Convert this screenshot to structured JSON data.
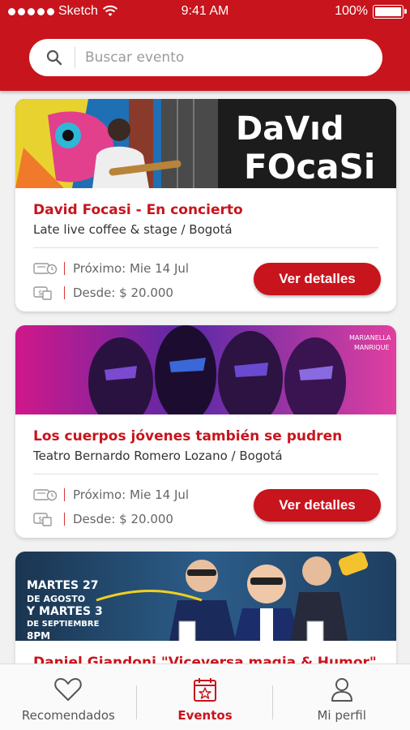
{
  "status_bar": {
    "carrier": "Sketch",
    "time": "9:41 AM",
    "battery": "100%"
  },
  "search": {
    "placeholder": "Buscar evento"
  },
  "events": [
    {
      "image_text": [
        "DaVıd",
        "FOcaSi"
      ],
      "title": "David Focasi  - En concierto",
      "venue": "Late live coffee & stage / Bogotá",
      "next_label": "Próximo: Mie 14 Jul",
      "price_label": "Desde: $ 20.000",
      "button": "Ver detalles"
    },
    {
      "image_text": [
        "MARIANELLA",
        "MANRIQUE"
      ],
      "title": "Los cuerpos jóvenes también se pudren",
      "venue": "Teatro Bernardo Romero Lozano / Bogotá",
      "next_label": "Próximo: Mie 14 Jul",
      "price_label": "Desde: $ 20.000",
      "button": "Ver detalles"
    },
    {
      "image_text": [
        "MARTES 27",
        "DE AGOSTO",
        "Y MARTES 3",
        "DE SEPTIEMBRE",
        "8PM"
      ],
      "title": "Daniel Giandoni \"Viceversa magia & Humor\""
    }
  ],
  "tabs": [
    {
      "label": "Recomendados",
      "icon": "heart-icon",
      "active": false
    },
    {
      "label": "Eventos",
      "icon": "calendar-star-icon",
      "active": true
    },
    {
      "label": "Mi perfil",
      "icon": "user-icon",
      "active": false
    }
  ],
  "colors": {
    "brand": "#c8141c",
    "background": "#f1f1f1",
    "tab_inactive": "#555555"
  }
}
